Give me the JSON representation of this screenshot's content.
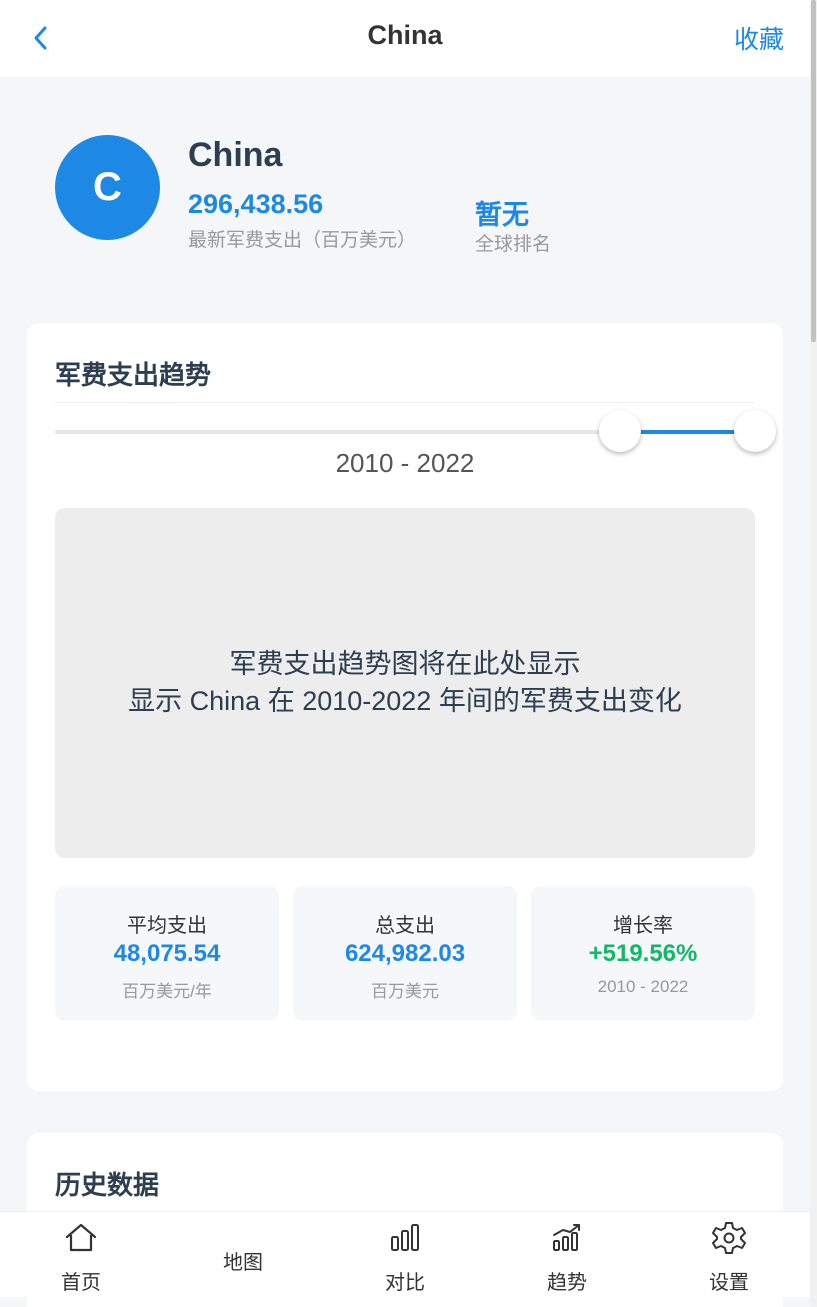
{
  "nav": {
    "title": "China",
    "favorite_label": "收藏",
    "back_icon": "chevron-left-icon"
  },
  "profile": {
    "avatar_letter": "C",
    "name": "China",
    "latest_spending": "296,438.56",
    "latest_spending_label": "最新军费支出（百万美元）",
    "global_rank": "暂无",
    "global_rank_label": "全球排名"
  },
  "trend": {
    "title": "军费支出趋势",
    "range_label": "2010 - 2022",
    "slider": {
      "min_year": 1949,
      "max_year": 2022,
      "start_year": 2010,
      "end_year": 2022
    },
    "chart_placeholder": {
      "line1": "军费支出趋势图将在此处显示",
      "line2": "显示 China 在 2010-2022 年间的军费支出变化"
    },
    "stats": [
      {
        "label": "平均支出",
        "value": "48,075.54",
        "sub": "百万美元/年"
      },
      {
        "label": "总支出",
        "value": "624,982.03",
        "sub": "百万美元"
      },
      {
        "label": "增长率",
        "value": "+519.56%",
        "sub": "2010 - 2022"
      }
    ]
  },
  "history": {
    "title": "历史数据"
  },
  "tabbar": {
    "items": [
      {
        "label": "首页",
        "icon": "home-icon"
      },
      {
        "label": "地图",
        "icon": ""
      },
      {
        "label": "对比",
        "icon": "bar-chart-icon"
      },
      {
        "label": "趋势",
        "icon": "trend-chart-icon"
      },
      {
        "label": "设置",
        "icon": "gear-icon"
      }
    ]
  },
  "colors": {
    "accent": "#1e88e5",
    "positive": "#12b76a",
    "background": "#f5f6f8",
    "card": "#ffffff"
  }
}
